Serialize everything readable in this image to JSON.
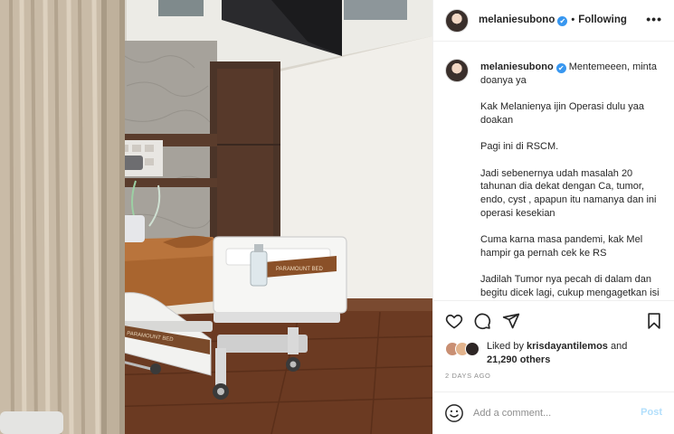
{
  "post": {
    "username": "melaniesubono",
    "verified_mark": "✔",
    "separator": "•",
    "follow_status": "Following",
    "more_label": "•••"
  },
  "caption": {
    "username": "melaniesubono",
    "paragraphs": [
      "Mentemeeen, minta doanya ya",
      "Kak Melanienya ijin Operasi dulu yaa doakan",
      "Pagi ini di RSCM.",
      "Jadi sebenernya udah masalah 20 tahunan dia dekat dengan Ca, tumor, endo, cyst , apapun itu namanya dan ini operasi kesekian",
      "Cuma karna masa pandemi, kak Mel hampir ga pernah cek ke RS",
      "Jadilah Tumor nya pecah di dalam dan begitu dicek lagi, cukup mengagetkan isi perut dan rahim."
    ]
  },
  "actions": {
    "icons": [
      "heart-icon",
      "comment-icon",
      "share-icon",
      "bookmark-icon"
    ]
  },
  "likes": {
    "prefix": "Liked by ",
    "first_liker": "krisdayantilemos",
    "and": " and",
    "others": "21,290 others"
  },
  "timestamp": "2 DAYS AGO",
  "comment": {
    "placeholder": "Add a comment...",
    "post_label": "Post"
  },
  "photo": {
    "bed_brand": "PARAMOUNT BED",
    "footboard_brand": "PARAMOUNT BED"
  },
  "colors": {
    "verified_blue": "#3897f0",
    "post_disabled": "#b2dffc",
    "border": "#efefef"
  }
}
